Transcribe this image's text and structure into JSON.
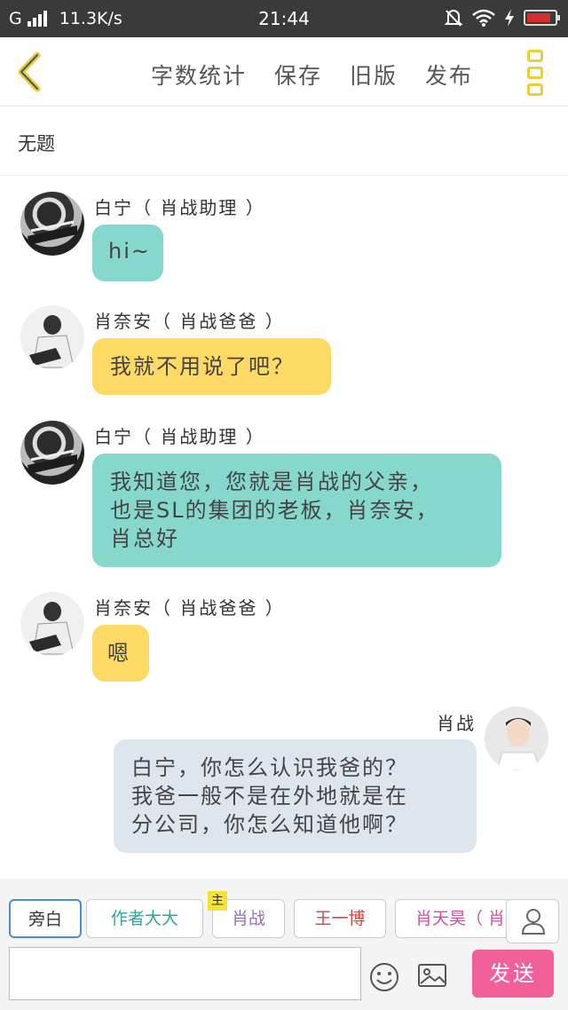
{
  "status_bar": {
    "network": "G",
    "speed": "11.3K/s",
    "time": "21:44"
  },
  "toolbar": {
    "items": [
      "字数统计",
      "保存",
      "旧版",
      "发布"
    ]
  },
  "title": "无题",
  "messages": [
    {
      "name": "白宁（ 肖战助理 ）",
      "text": "hi~",
      "color": "#86d8cc"
    },
    {
      "name": "肖奈安（ 肖战爸爸 ）",
      "text": "我就不用说了吧？",
      "color": "#fdda66"
    },
    {
      "name": "白宁（ 肖战助理 ）",
      "text_lines": [
        "我知道您，您就是肖战的父亲，",
        "也是SL的集团的老板，肖奈安，",
        "肖总好"
      ],
      "color": "#86d8cc"
    },
    {
      "name": "肖奈安（ 肖战爸爸 ）",
      "text": "嗯",
      "color": "#fdda66"
    },
    {
      "name": "肖战",
      "text_lines": [
        "白宁，你怎么认识我爸的？",
        "我爸一般不是在外地就是在",
        "分公司，你怎么知道他啊？"
      ],
      "color": "#dde6ec"
    }
  ],
  "roles": {
    "items": [
      {
        "label": "旁白",
        "color": "#333333"
      },
      {
        "label": "作者大大",
        "color": "#2aa89a"
      },
      {
        "label": "肖战",
        "color": "#9b6bc4"
      },
      {
        "label": "王一博",
        "color": "#d9443a"
      },
      {
        "label": "肖天昊（ 肖",
        "color": "#d94aa0"
      }
    ],
    "host_badge": "主"
  },
  "composer": {
    "input_value": "",
    "send_label": "发送"
  }
}
